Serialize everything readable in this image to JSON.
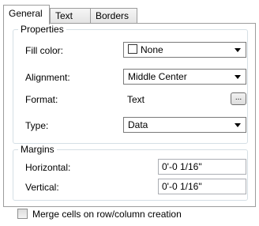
{
  "tabs": [
    "General",
    "Text",
    "Borders"
  ],
  "properties": {
    "title": "Properties",
    "fill_color_label": "Fill color:",
    "fill_color_value": "None",
    "alignment_label": "Alignment:",
    "alignment_value": "Middle Center",
    "format_label": "Format:",
    "format_value": "Text",
    "format_button": "...",
    "type_label": "Type:",
    "type_value": "Data"
  },
  "margins": {
    "title": "Margins",
    "horizontal_label": "Horizontal:",
    "horizontal_value": "0'-0 1/16\"",
    "vertical_label": "Vertical:",
    "vertical_value": "0'-0 1/16\""
  },
  "merge_checkbox": {
    "label": "Merge cells on row/column creation",
    "checked": false
  }
}
